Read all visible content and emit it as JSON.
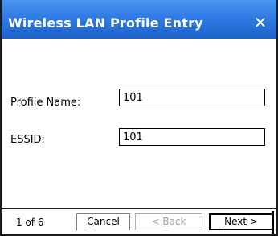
{
  "window": {
    "title": "Wireless LAN Profile Entry",
    "close_glyph": "✕"
  },
  "form": {
    "profile_name": {
      "label": "Profile Name:",
      "value": "101"
    },
    "essid": {
      "label": "ESSID:",
      "value": "101"
    }
  },
  "footer": {
    "page_indicator": "1 of 6",
    "cancel": {
      "accel": "C",
      "rest": "ancel"
    },
    "back": {
      "prefix": "< ",
      "accel": "B",
      "rest": "ack"
    },
    "next": {
      "accel": "N",
      "rest": "ext >"
    }
  },
  "colors": {
    "titlebar": "#2f7be3",
    "disabled_text": "#a0a0a0"
  }
}
